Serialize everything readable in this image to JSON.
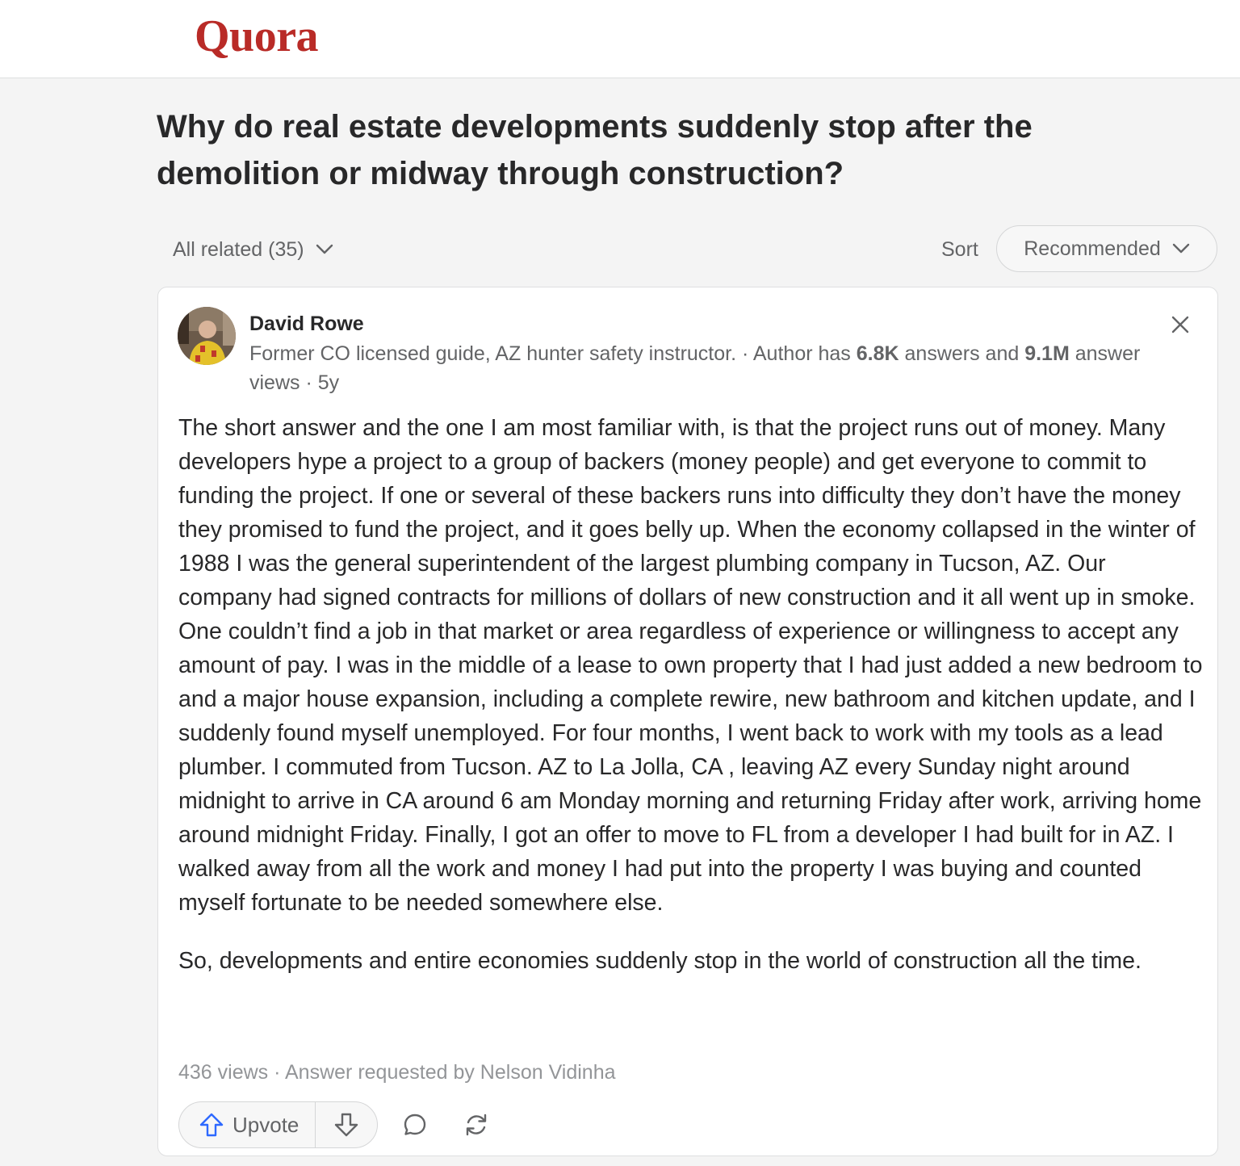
{
  "header": {
    "logo": "Quora"
  },
  "question": {
    "title": "Why do real estate developments suddenly stop after the demolition or midway through construction?"
  },
  "filters": {
    "related_label": "All related (35)",
    "sort_label": "Sort",
    "sort_value": "Recommended"
  },
  "answer": {
    "author": {
      "name": "David Rowe",
      "credential": "Former CO licensed guide, AZ hunter safety instructor.",
      "sep1": " · Author has ",
      "answers_count": "6.8K",
      "answers_text": " answers and ",
      "views_count": "9.1M",
      "views_text": " answer views · 5y"
    },
    "paragraphs": [
      "The short answer and the one I am most familiar with, is that the project runs out of money. Many developers hype a project to a group of backers (money people) and get everyone to commit to funding the project. If one or several of these backers runs into difficulty they don’t have the money they promised to fund the project, and it goes belly up. When the economy collapsed in the winter of 1988 I was the general superintendent of the largest plumbing company in Tucson, AZ. Our company had signed contracts for millions of dollars of new construction and it all went up in smoke. One couldn’t find a job in that market or area regardless of experience or willingness to accept any amount of pay. I was in the middle of a lease to own property that I had just added a new bedroom to and a major house expansion, including a complete rewire, new bathroom and kitchen update, and I suddenly found myself unemployed. For four months, I went back to work with my tools as a lead plumber. I commuted from Tucson. AZ to La Jolla, CA , leaving AZ every Sunday night around midnight to arrive in CA around 6 am Monday morning and returning Friday after work, arriving home around midnight Friday. Finally, I got an offer to move to FL from a developer I had built for in AZ. I walked away from all the work and money I had put into the property I was buying and counted myself fortunate to be needed somewhere else.",
      "So, developments and entire economies suddenly stop in the world of construction all the time."
    ],
    "meta": "436 views · Answer requested by Nelson Vidinha",
    "upvote_label": "Upvote"
  },
  "colors": {
    "brand": "#b92b27",
    "upvote_icon": "#2e69ff",
    "muted_text": "#636466"
  },
  "icons": [
    "chevron-down-icon",
    "close-icon",
    "upvote-arrow-icon",
    "downvote-arrow-icon",
    "comment-icon",
    "share-icon"
  ]
}
